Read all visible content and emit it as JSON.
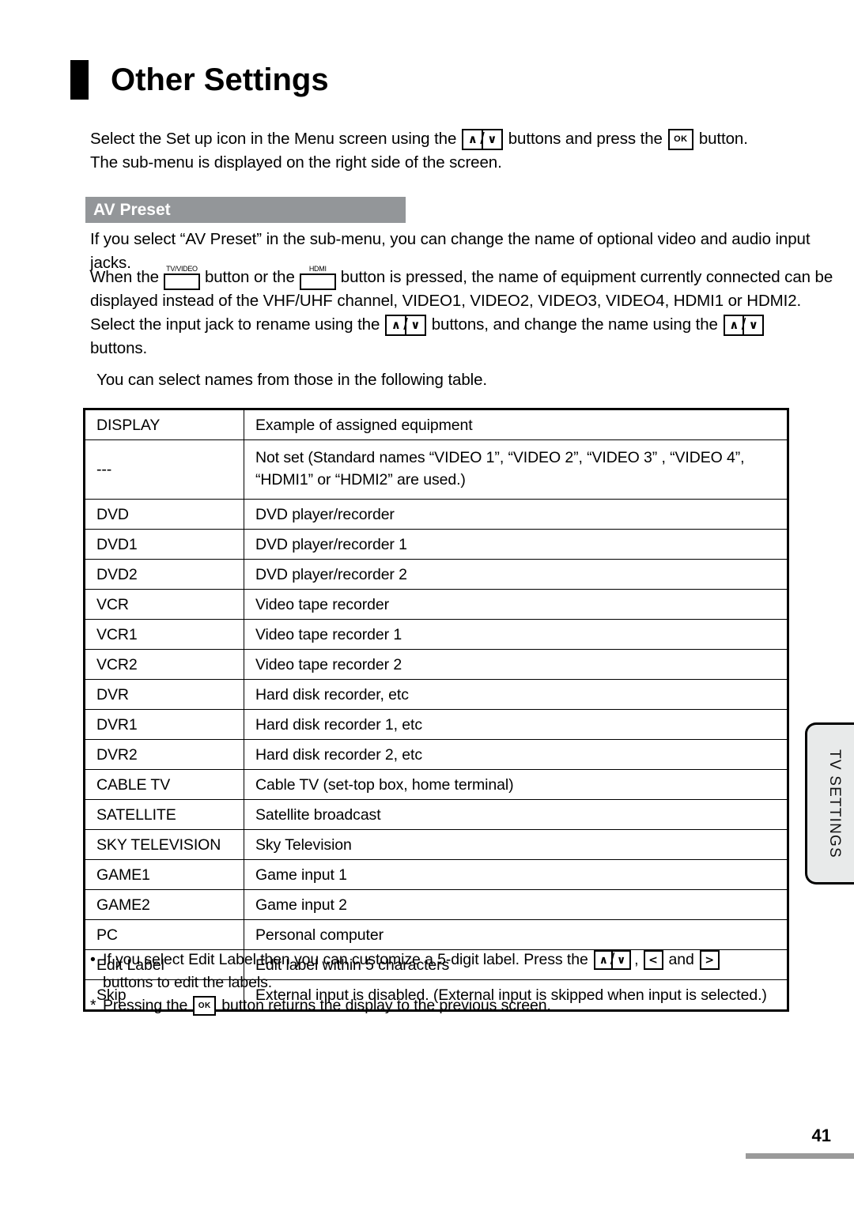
{
  "page": {
    "title": "Other Settings",
    "number": "41"
  },
  "intro": {
    "line1_a": "Select the Set up icon in the Menu screen using the",
    "line1_b": "buttons and press the",
    "line1_c": "button.",
    "line2": "The sub-menu is displayed on the right side of the screen."
  },
  "section": {
    "heading": "AV Preset"
  },
  "body": {
    "p1_line1": "If you select “AV Preset” in the sub-menu, you can change the name of optional video and audio input",
    "p1_line2": "jacks.",
    "p2_line1_a": "When the",
    "p2_line1_b": "button or the",
    "p2_line1_c": "button is pressed, the name of equipment currently connected can be",
    "p2_line2": "displayed instead of the VHF/UHF channel, VIDEO1, VIDEO2, VIDEO3, VIDEO4, HDMI1 or HDMI2.",
    "p2_line3_a": "Select the input jack to rename using the",
    "p2_line3_b": "buttons, and change the name using the",
    "p2_line4": "buttons.",
    "p3": "You can select names from those in the following table."
  },
  "keys": {
    "up": "∧",
    "down": "∨",
    "left": "<",
    "right": ">",
    "ok": "OK",
    "slash": "/",
    "tv_video_caption": "TV/VIDEO",
    "hdmi_caption": "HDMI"
  },
  "table": {
    "headers": [
      "DISPLAY",
      "Example of assigned equipment"
    ],
    "rows": [
      {
        "display": "---",
        "example_line1": "Not set (Standard names “VIDEO 1”, “VIDEO 2”, “VIDEO 3” , “VIDEO 4”,",
        "example_line2": "“HDMI1” or “HDMI2” are used.)"
      },
      {
        "display": "DVD",
        "example": "DVD player/recorder"
      },
      {
        "display": "DVD1",
        "example": "DVD player/recorder 1"
      },
      {
        "display": "DVD2",
        "example": "DVD player/recorder 2"
      },
      {
        "display": "VCR",
        "example": "Video tape recorder"
      },
      {
        "display": "VCR1",
        "example": "Video tape recorder 1"
      },
      {
        "display": "VCR2",
        "example": "Video tape recorder 2"
      },
      {
        "display": "DVR",
        "example": "Hard disk recorder, etc"
      },
      {
        "display": "DVR1",
        "example": "Hard disk recorder 1, etc"
      },
      {
        "display": "DVR2",
        "example": "Hard disk recorder 2, etc"
      },
      {
        "display": "CABLE TV",
        "example": "Cable TV (set-top box, home terminal)"
      },
      {
        "display": "SATELLITE",
        "example": "Satellite broadcast"
      },
      {
        "display": "SKY TELEVISION",
        "example": "Sky Television"
      },
      {
        "display": "GAME1",
        "example": "Game input 1"
      },
      {
        "display": "GAME2",
        "example": "Game input 2"
      },
      {
        "display": "PC",
        "example": "Personal computer"
      },
      {
        "display": "Edit Label",
        "example": "Edit label within 5 characters"
      },
      {
        "display": "Skip",
        "example": "External input is disabled. (External input is skipped when input is selected.)"
      }
    ]
  },
  "side_tab": {
    "label": "TV SETTINGS"
  },
  "notes": {
    "bullet_marker": "•",
    "note1_a": "If you select Edit Label then you can customize a 5-digit label. Press the",
    "note1_comma": ",",
    "note1_and": "and",
    "note1_line2": "buttons to edit the labels.",
    "asterisk_marker": "*",
    "note2_a": "Pressing the",
    "note2_b": "button returns the display to the previous screen."
  }
}
